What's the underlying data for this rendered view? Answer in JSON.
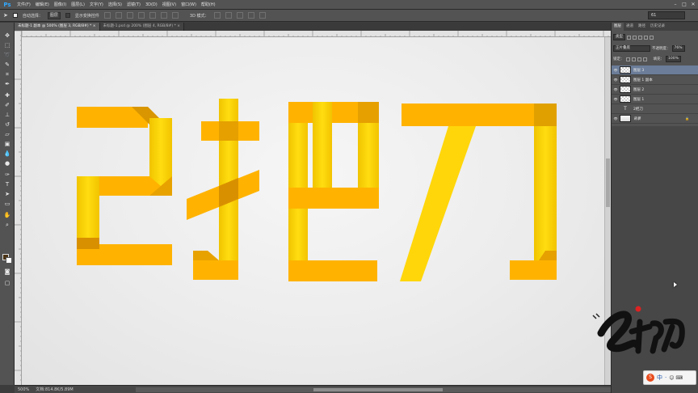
{
  "app": {
    "logo": "Ps"
  },
  "menu": [
    "文件(F)",
    "编辑(E)",
    "图像(I)",
    "图层(L)",
    "文字(Y)",
    "选择(S)",
    "滤镜(T)",
    "3D(D)",
    "视图(V)",
    "窗口(W)",
    "帮助(H)"
  ],
  "window_controls": [
    "–",
    "□",
    "✕"
  ],
  "options": {
    "auto_select_label": "自动选择：",
    "auto_select_value": "图层",
    "show_transform_label": "显示变换控件",
    "mode_3d_label": "3D 模式：",
    "workspace_value": "61"
  },
  "tabs": [
    {
      "label": "未标题-1 副本 @ 500% (图层 3, RGB/8#) *",
      "close": "×"
    },
    {
      "label": "未标题-1.psd @ 200% (图层 4, RGB/8#) *",
      "close": "×"
    }
  ],
  "status": {
    "zoom": "500%",
    "doc": "文档:814.8K/5.89M"
  },
  "panel": {
    "tabs": [
      "图层",
      "通道",
      "路径",
      "历史记录"
    ],
    "filter_kind": "类型",
    "blend_mode": "正片叠底",
    "opacity_label": "不透明度：",
    "opacity_value": "76%",
    "lock_label": "锁定：",
    "fill_label": "填充：",
    "fill_value": "100%",
    "layers": [
      {
        "name": "图层 3",
        "type": "pixel",
        "selected": true
      },
      {
        "name": "图层 1 副本",
        "type": "pixel",
        "selected": false
      },
      {
        "name": "图层 2",
        "type": "pixel",
        "selected": false
      },
      {
        "name": "图层 1",
        "type": "pixel",
        "selected": false
      },
      {
        "name": "2把刀",
        "type": "text",
        "selected": false
      },
      {
        "name": "背景",
        "type": "background",
        "selected": false
      }
    ]
  },
  "ime": {
    "logo": "S",
    "mode": "中",
    "punct": "·",
    "icons": "☺ ⌨"
  },
  "colors": {
    "orange": "#ffb300",
    "yellow": "#ffd60a",
    "accent": "#31a8ff"
  }
}
